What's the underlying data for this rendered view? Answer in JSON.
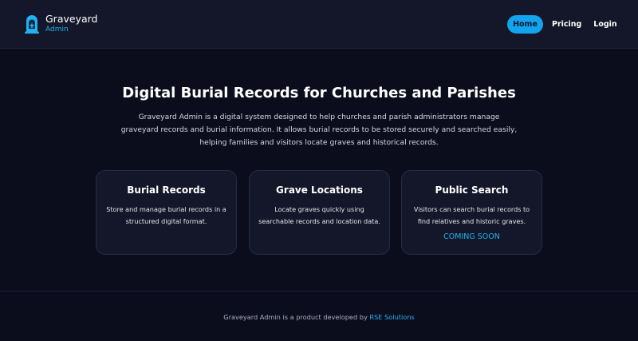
{
  "brand": {
    "title": "Graveyard",
    "subtitle": "Admin"
  },
  "nav": {
    "home": "Home",
    "pricing": "Pricing",
    "login": "Login"
  },
  "hero": {
    "title": "Digital Burial Records for Churches and Parishes",
    "description": "Graveyard Admin is a digital system designed to help churches and parish administrators manage graveyard records and burial information. It allows burial records to be stored securely and searched easily, helping families and visitors locate graves and historical records."
  },
  "features": [
    {
      "title": "Burial Records",
      "description": "Store and manage burial records in a structured digital format."
    },
    {
      "title": "Grave Locations",
      "description": "Locate graves quickly using searchable records and location data."
    },
    {
      "title": "Public Search",
      "description": "Visitors can search burial records to find relatives and historic graves.",
      "badge": "COMING SOON"
    }
  ],
  "footer": {
    "text": "Graveyard Admin is a product developed by",
    "link": "RSE Solutions"
  },
  "colors": {
    "accent": "#22b2f0",
    "background": "#0b0d1c",
    "surface": "#131729"
  }
}
